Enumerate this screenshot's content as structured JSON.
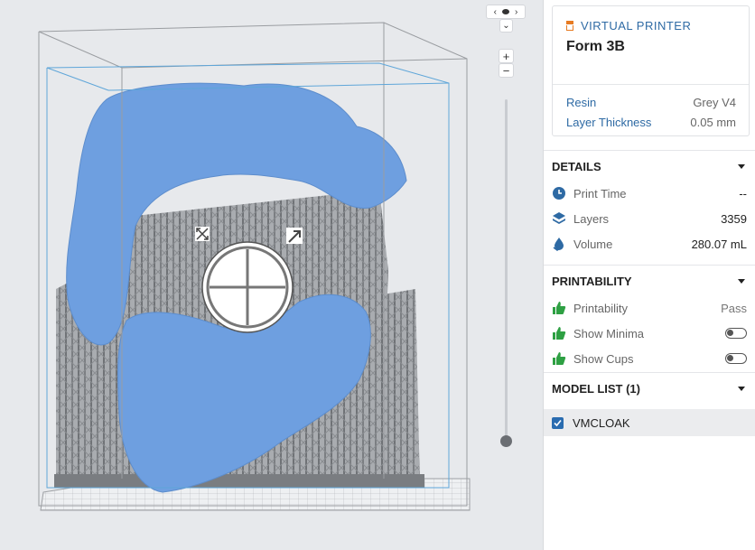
{
  "printer": {
    "header": "VIRTUAL PRINTER",
    "name": "Form 3B",
    "specs": [
      {
        "label": "Resin",
        "value": "Grey V4"
      },
      {
        "label": "Layer Thickness",
        "value": "0.05 mm"
      }
    ]
  },
  "details": {
    "title": "DETAILS",
    "rows": [
      {
        "icon": "clock-icon",
        "label": "Print Time",
        "value": "--"
      },
      {
        "icon": "layers-icon",
        "label": "Layers",
        "value": "3359"
      },
      {
        "icon": "volume-icon",
        "label": "Volume",
        "value": "280.07 mL"
      }
    ]
  },
  "printability": {
    "title": "PRINTABILITY",
    "rows": [
      {
        "icon": "thumbs-up-icon",
        "label": "Printability",
        "value": "Pass"
      },
      {
        "icon": "thumbs-up-icon",
        "label": "Show Minima",
        "value": ""
      },
      {
        "icon": "thumbs-up-icon",
        "label": "Show Cups",
        "value": ""
      }
    ]
  },
  "model_list": {
    "title": "MODEL LIST (1)",
    "items": [
      {
        "name": "VMCLOAK",
        "checked": true
      }
    ]
  },
  "viewport": {
    "nav_up": "‹",
    "nav_right": "›",
    "nav_down": "⌄",
    "zoom_in": "+",
    "zoom_out": "−"
  },
  "colors": {
    "accent": "#2e6aa4",
    "model": "#6e9fe0",
    "support": "#8a8d91",
    "pass": "#2ea043"
  }
}
